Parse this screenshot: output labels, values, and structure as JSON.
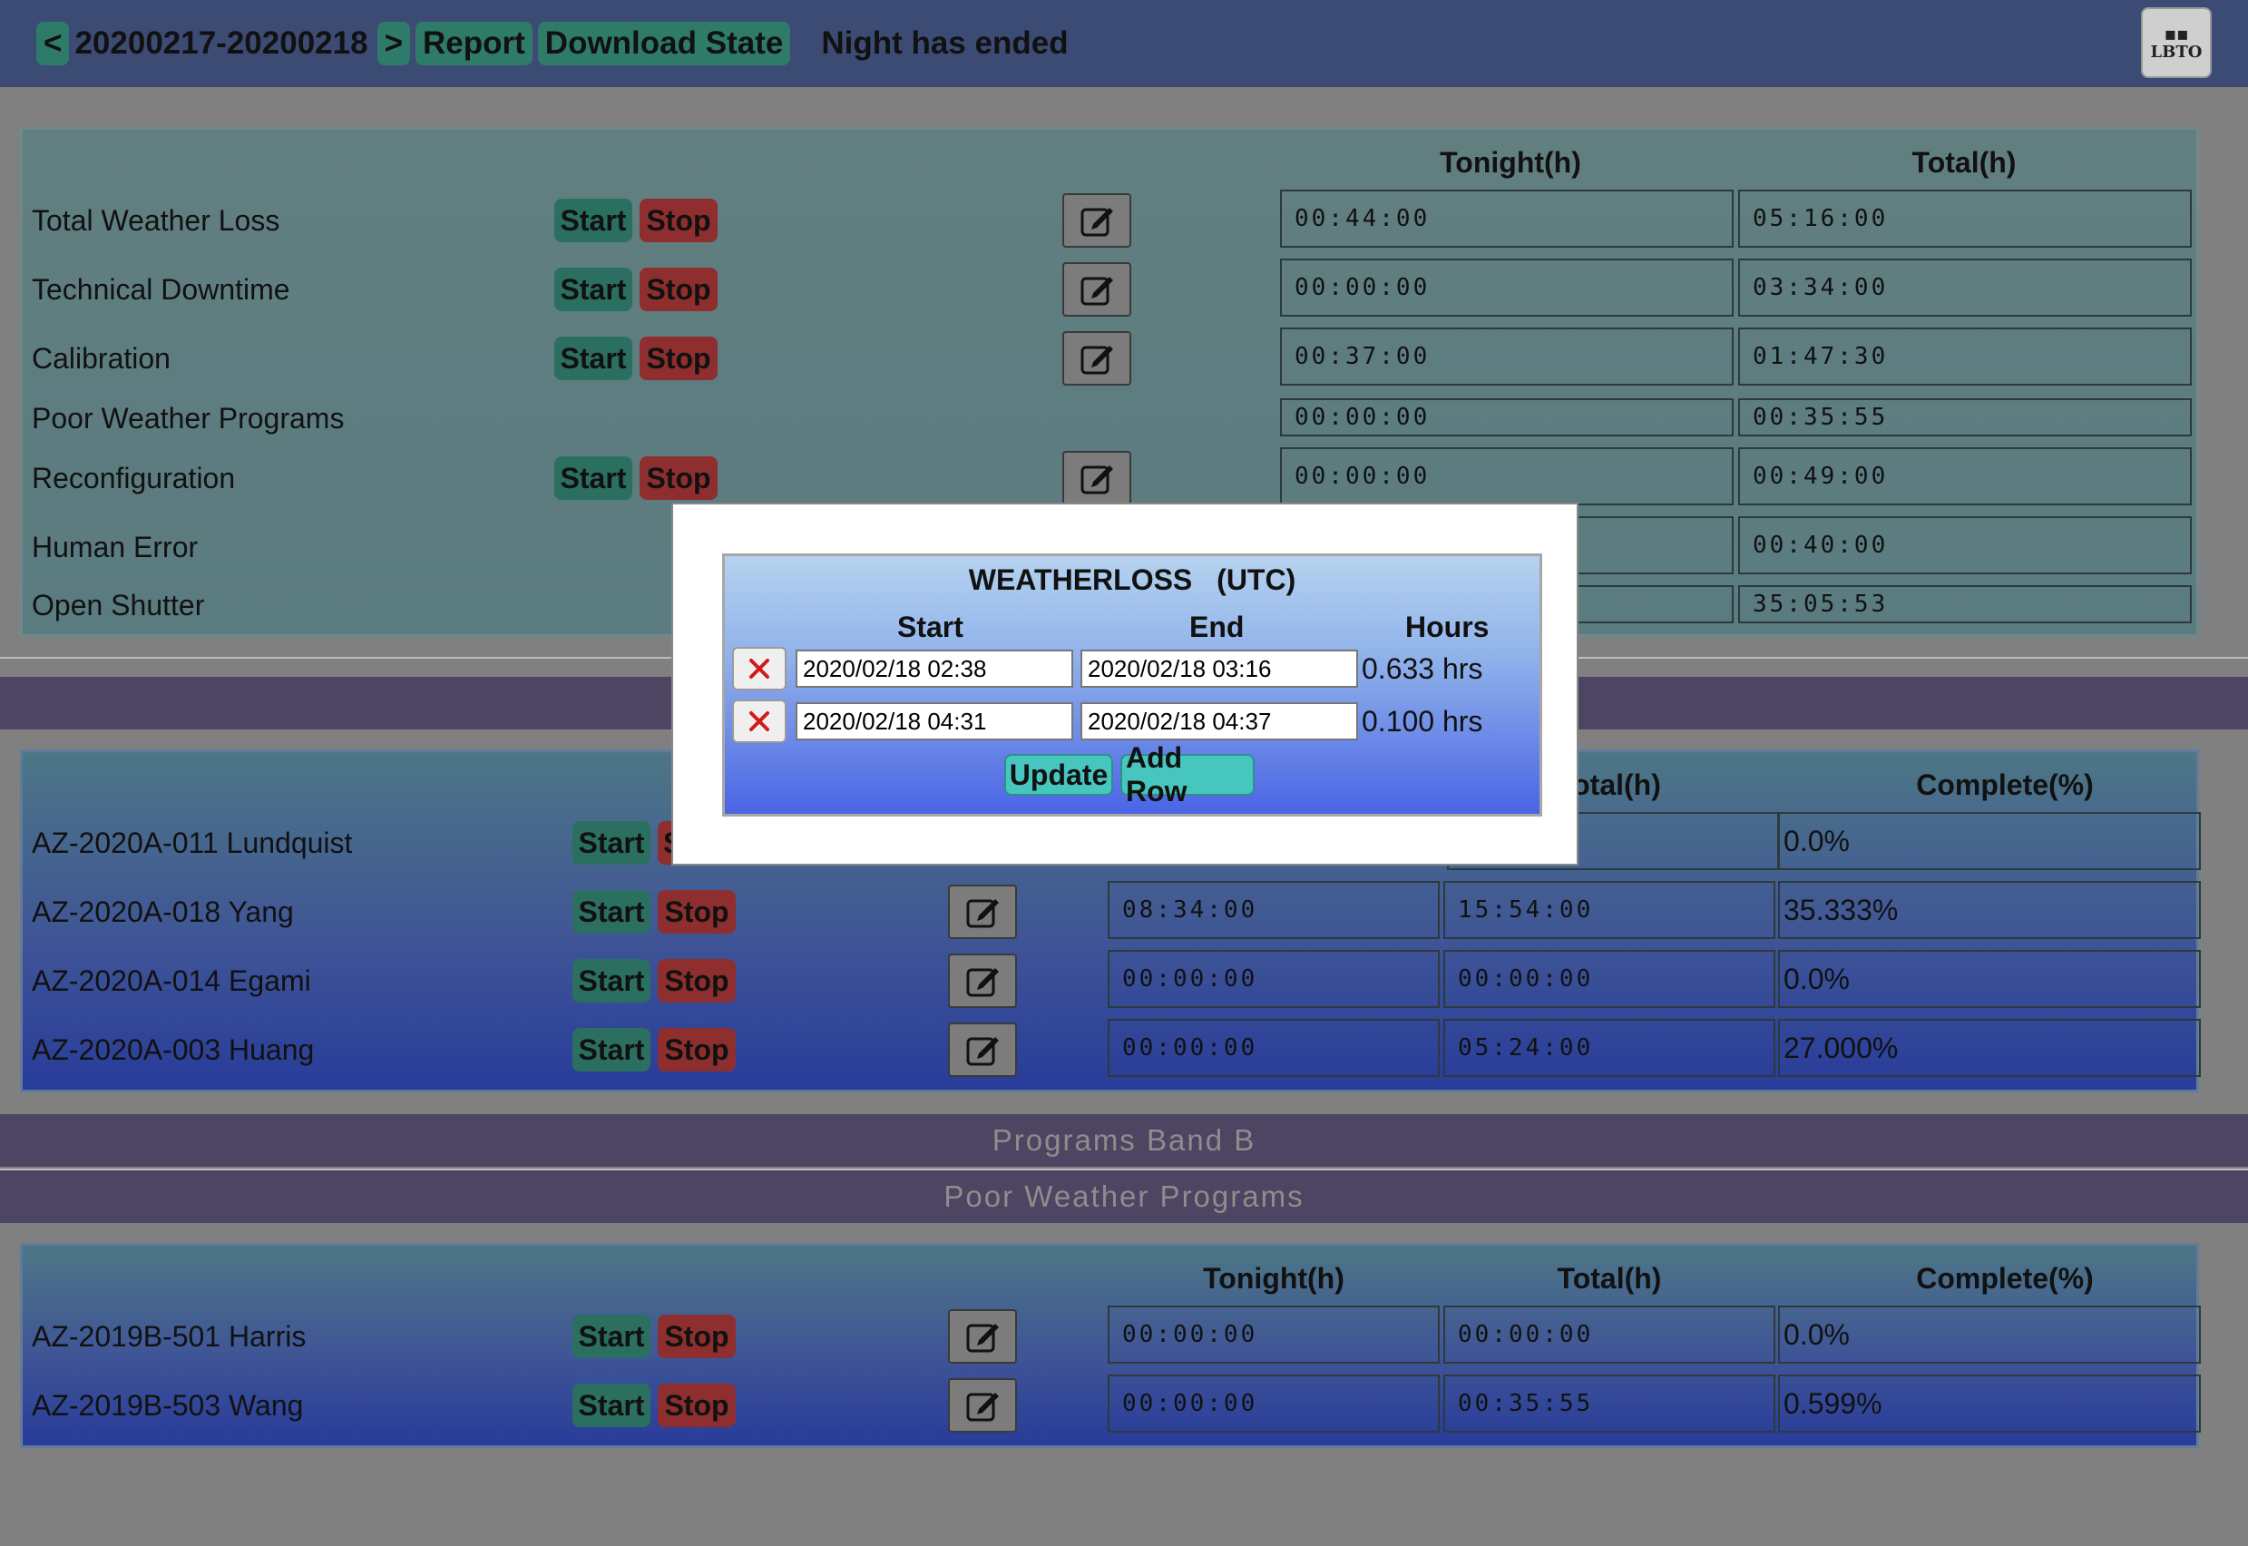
{
  "header": {
    "prev": "<",
    "date_range": "20200217-20200218",
    "next": ">",
    "report": "Report",
    "download_state": "Download State",
    "night_status": "Night has ended",
    "logo_text": "LBTO"
  },
  "loss_panel": {
    "col_tonight": "Tonight(h)",
    "col_total": "Total(h)",
    "start_label": "Start",
    "stop_label": "Stop",
    "rows": [
      {
        "label": "Total Weather Loss",
        "tonight": "00:44:00",
        "total": "05:16:00"
      },
      {
        "label": "Technical Downtime",
        "tonight": "00:00:00",
        "total": "03:34:00"
      },
      {
        "label": "Calibration",
        "tonight": "00:37:00",
        "total": "01:47:30"
      },
      {
        "label": "Poor Weather Programs",
        "tonight": "00:00:00",
        "total": "00:35:55"
      },
      {
        "label": "Reconfiguration",
        "tonight": "00:00:00",
        "total": "00:49:00"
      },
      {
        "label": "Human Error",
        "tonight": "",
        "total": "00:40:00"
      },
      {
        "label": "Open Shutter",
        "tonight": "",
        "total": "35:05:53"
      }
    ]
  },
  "band_a": {
    "col_total_partial": "otal(h)",
    "col_complete": "Complete(%)",
    "start_label": "Start",
    "stop_label": "Stop",
    "stop_partial": "S",
    "rows": [
      {
        "label": "AZ-2020A-011 Lundquist",
        "tonight": "",
        "total": "",
        "complete": "0.0%"
      },
      {
        "label": "AZ-2020A-018 Yang",
        "tonight": "08:34:00",
        "total": "15:54:00",
        "complete": "35.333%"
      },
      {
        "label": "AZ-2020A-014 Egami",
        "tonight": "00:00:00",
        "total": "00:00:00",
        "complete": "0.0%"
      },
      {
        "label": "AZ-2020A-003 Huang",
        "tonight": "00:00:00",
        "total": "05:24:00",
        "complete": "27.000%"
      }
    ]
  },
  "sections": {
    "band_b": "Programs Band B",
    "poor_weather": "Poor Weather Programs"
  },
  "poor_weather_panel": {
    "col_tonight": "Tonight(h)",
    "col_total": "Total(h)",
    "col_complete": "Complete(%)",
    "start_label": "Start",
    "stop_label": "Stop",
    "rows": [
      {
        "label": "AZ-2019B-501 Harris",
        "tonight": "00:00:00",
        "total": "00:00:00",
        "complete": "0.0%"
      },
      {
        "label": "AZ-2019B-503 Wang",
        "tonight": "00:00:00",
        "total": "00:35:55",
        "complete": "0.599%"
      }
    ]
  },
  "modal": {
    "title": "WEATHERLOSS (UTC)",
    "col_start": "Start",
    "col_end": "End",
    "col_hours": "Hours",
    "rows": [
      {
        "start": "2020/02/18 02:38",
        "end": "2020/02/18 03:16",
        "hours": "0.633 hrs"
      },
      {
        "start": "2020/02/18 04:31",
        "end": "2020/02/18 04:37",
        "hours": "0.100 hrs"
      }
    ],
    "update_label": "Update",
    "add_row_label": "Add Row"
  }
}
